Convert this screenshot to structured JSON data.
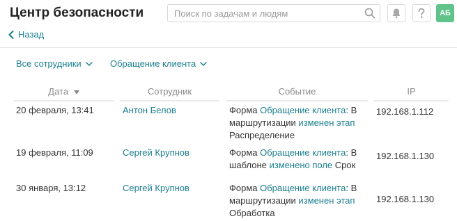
{
  "header": {
    "title": "Центр безопасности",
    "search_placeholder": "Поиск по задачам и людям",
    "avatar_initials": "АБ",
    "accent_color": "#1a7f8e",
    "avatar_color": "#5fc38a"
  },
  "back": {
    "label": "Назад"
  },
  "filters": [
    {
      "label": "Все сотрудники"
    },
    {
      "label": "Обращение клиента"
    }
  ],
  "table": {
    "columns": [
      "Дата",
      "Сотрудник",
      "Событие",
      "IP"
    ],
    "sort_column": "Дата",
    "rows": [
      {
        "date": "20 февраля, 13:41",
        "employee": "Антон Белов",
        "event": {
          "prefix": "Форма ",
          "form_link": "Обращение клиента",
          "mid": ": В маршрутизации ",
          "action_link": "изменен этап",
          "suffix": " Распределение"
        },
        "ip": "192.168.1.112"
      },
      {
        "date": "19 февраля, 11:09",
        "employee": "Сергей Крупнов",
        "event": {
          "prefix": "Форма ",
          "form_link": "Обращение клиента",
          "mid": ": В шаблоне ",
          "action_link": "изменено поле",
          "suffix": " Срок"
        },
        "ip": "192.168.1.130"
      },
      {
        "date": "30 января, 13:12",
        "employee": "Сергей Крупнов",
        "event": {
          "prefix": "Форма ",
          "form_link": "Обращение клиента",
          "mid": ": В маршрутизации ",
          "action_link": "изменен этап",
          "suffix": " Обработка"
        },
        "ip": "192.168.1.130"
      }
    ]
  }
}
